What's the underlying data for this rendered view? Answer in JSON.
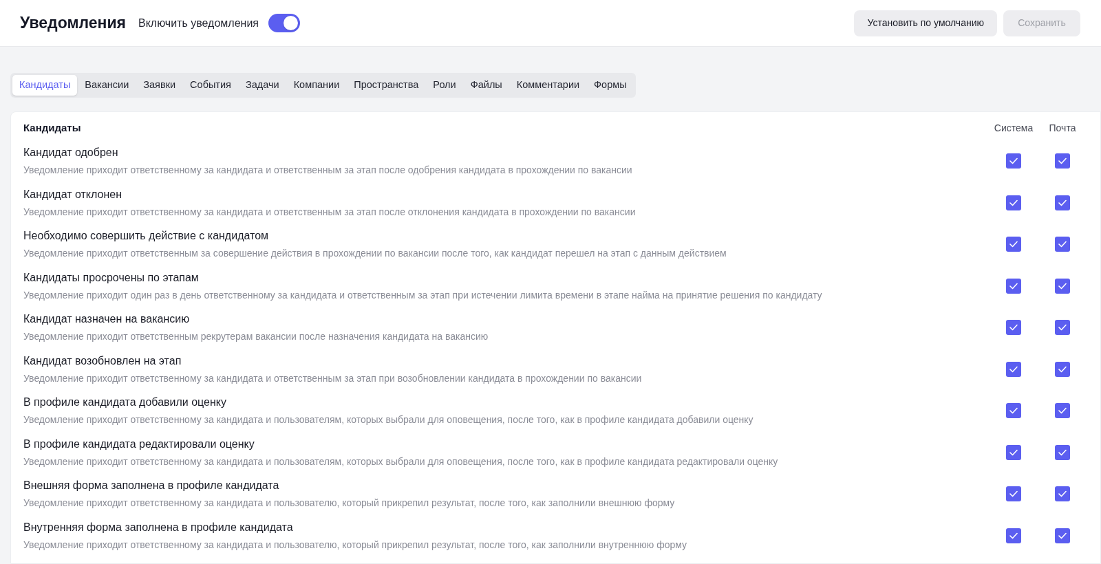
{
  "header": {
    "title": "Уведомления",
    "toggle": {
      "label": "Включить уведомления",
      "on": true
    },
    "buttons": [
      {
        "label": "Установить по умолчанию",
        "disabled": false
      },
      {
        "label": "Сохранить",
        "disabled": true
      }
    ]
  },
  "tabs": [
    {
      "label": "Кандидаты",
      "selected": true
    },
    {
      "label": "Вакансии",
      "selected": false
    },
    {
      "label": "Заявки",
      "selected": false
    },
    {
      "label": "События",
      "selected": false
    },
    {
      "label": "Задачи",
      "selected": false
    },
    {
      "label": "Компании",
      "selected": false
    },
    {
      "label": "Пространства",
      "selected": false
    },
    {
      "label": "Роли",
      "selected": false
    },
    {
      "label": "Файлы",
      "selected": false
    },
    {
      "label": "Комментарии",
      "selected": false
    },
    {
      "label": "Формы",
      "selected": false
    }
  ],
  "section": {
    "title": "Кандидаты",
    "columns": [
      "Система",
      "Почта"
    ],
    "rows": [
      {
        "title": "Кандидат одобрен",
        "description": "Уведомление приходит ответственному за кандидата и ответственным за этап после одобрения кандидата в прохождении по вакансии",
        "system": true,
        "mail": true
      },
      {
        "title": "Кандидат отклонен",
        "description": "Уведомление приходит ответственному за кандидата и ответственным за этап после отклонения кандидата в прохождении по вакансии",
        "system": true,
        "mail": true
      },
      {
        "title": "Необходимо совершить действие с кандидатом",
        "description": "Уведомление приходит ответственным за совершение действия в прохождении по вакансии после того, как кандидат перешел на этап с данным действием",
        "system": true,
        "mail": true
      },
      {
        "title": "Кандидаты просрочены по этапам",
        "description": "Уведомление приходит один раз в день ответственному за кандидата и ответственным за этап при истечении лимита времени в этапе найма на принятие решения по кандидату",
        "system": true,
        "mail": true
      },
      {
        "title": "Кандидат назначен на вакансию",
        "description": "Уведомление приходит ответственным рекрутерам вакансии после назначения кандидата на вакансию",
        "system": true,
        "mail": true
      },
      {
        "title": "Кандидат возобновлен на этап",
        "description": "Уведомление приходит ответственному за кандидата и ответственным за этап при возобновлении кандидата в прохождении по вакансии",
        "system": true,
        "mail": true
      },
      {
        "title": "В профиле кандидата добавили оценку",
        "description": "Уведомление приходит ответственному за кандидата и пользователям, которых выбрали для оповещения, после того, как в профиле кандидата добавили оценку",
        "system": true,
        "mail": true
      },
      {
        "title": "В профиле кандидата редактировали оценку",
        "description": "Уведомление приходит ответственному за кандидата и пользователям, которых выбрали для оповещения, после того, как в профиле кандидата редактировали оценку",
        "system": true,
        "mail": true
      },
      {
        "title": "Внешняя форма заполнена в профиле кандидата",
        "description": "Уведомление приходит ответственному за кандидата и пользователю, который прикрепил результат, после того, как заполнили внешнюю форму",
        "system": true,
        "mail": true
      },
      {
        "title": "Внутренняя форма заполнена в профиле кандидата",
        "description": "Уведомление приходит ответственному за кандидата и пользователю, который прикрепил результат, после того, как заполнили внутреннюю форму",
        "system": true,
        "mail": true
      }
    ]
  }
}
